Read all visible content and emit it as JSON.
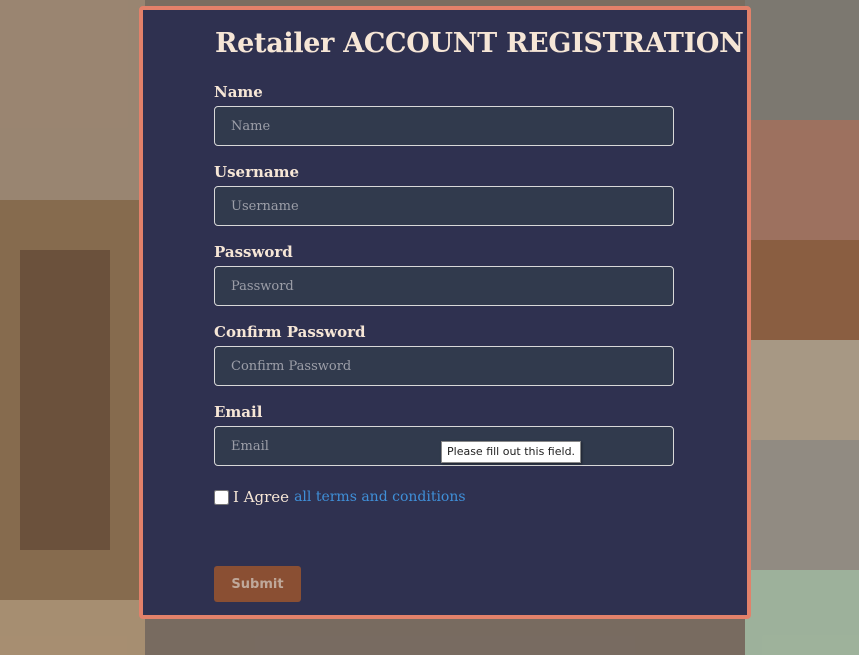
{
  "form": {
    "title": "Retailer ACCOUNT REGISTRATION",
    "fields": [
      {
        "label": "Name",
        "placeholder": "Name"
      },
      {
        "label": "Username",
        "placeholder": "Username"
      },
      {
        "label": "Password",
        "placeholder": "Password"
      },
      {
        "label": "Confirm Password",
        "placeholder": "Confirm Password"
      },
      {
        "label": "Email",
        "placeholder": "Email"
      }
    ],
    "validation_tooltip": "Please fill out this field.",
    "agree_text": "I Agree",
    "terms_link": "all terms and conditions",
    "submit_label": "Submit"
  },
  "colors": {
    "panel_bg": "#2f3150",
    "panel_border": "#e2816a",
    "link": "#3f8fd8",
    "submit_bg": "#8a4f33"
  }
}
